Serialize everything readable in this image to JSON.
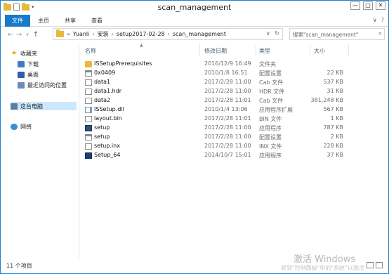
{
  "window": {
    "title": "scan_management"
  },
  "quick_access_toolbar": {
    "items": [
      "folder-icon",
      "properties-icon",
      "new-folder-icon",
      "dropdown-icon"
    ]
  },
  "window_controls": {
    "minimize": "—",
    "maximize": "□",
    "close": "✕"
  },
  "ribbon": {
    "tabs": [
      {
        "label": "文件"
      },
      {
        "label": "主页"
      },
      {
        "label": "共享"
      },
      {
        "label": "查看"
      }
    ],
    "expand_icon": "∨",
    "help_icon": "?"
  },
  "nav": {
    "back": "←",
    "forward": "→",
    "history": "∨",
    "up": "↑"
  },
  "address": {
    "prefix": "«",
    "crumbs": [
      "Yuanli",
      "安装",
      "setup2017-02-28",
      "scan_management"
    ],
    "separator": "›",
    "dropdown": "∨",
    "refresh": "↻"
  },
  "search": {
    "placeholder": "搜索\"scan_management\"",
    "icon": "search-icon"
  },
  "sidebar": {
    "items": [
      {
        "label": "收藏夹",
        "icon": "star-icon"
      },
      {
        "label": "下载",
        "icon": "downloads-icon"
      },
      {
        "label": "桌面",
        "icon": "desktop-icon"
      },
      {
        "label": "最近访问的位置",
        "icon": "recent-places-icon"
      },
      {
        "label": "这台电脑",
        "icon": "computer-icon"
      },
      {
        "label": "网络",
        "icon": "network-icon"
      }
    ]
  },
  "columns": {
    "name": "名称",
    "date": "修改日期",
    "type": "类型",
    "size": "大小"
  },
  "files": [
    {
      "name": "ISSetupPrerequisites",
      "date": "2016/12/9 16:49",
      "type": "文件夹",
      "size": "",
      "icon": "folder"
    },
    {
      "name": "0x0409",
      "date": "2010/1/8 16:51",
      "type": "配置设置",
      "size": "22 KB",
      "icon": "cfg"
    },
    {
      "name": "data1",
      "date": "2017/2/28 11:00",
      "type": "Cab 文件",
      "size": "537 KB",
      "icon": "file"
    },
    {
      "name": "data1.hdr",
      "date": "2017/2/28 11:00",
      "type": "HDR 文件",
      "size": "31 KB",
      "icon": "file"
    },
    {
      "name": "data2",
      "date": "2017/2/28 11:01",
      "type": "Cab 文件",
      "size": "381,248 KB",
      "icon": "file"
    },
    {
      "name": "ISSetup.dll",
      "date": "2010/1/4 13:06",
      "type": "应用程序扩展",
      "size": "567 KB",
      "icon": "dll"
    },
    {
      "name": "layout.bin",
      "date": "2017/2/28 11:01",
      "type": "BIN 文件",
      "size": "1 KB",
      "icon": "file"
    },
    {
      "name": "setup",
      "date": "2017/2/28 11:00",
      "type": "应用程序",
      "size": "787 KB",
      "icon": "app"
    },
    {
      "name": "setup",
      "date": "2017/2/28 11:00",
      "type": "配置设置",
      "size": "2 KB",
      "icon": "cfg"
    },
    {
      "name": "setup.inx",
      "date": "2017/2/28 11:00",
      "type": "INX 文件",
      "size": "228 KB",
      "icon": "file"
    },
    {
      "name": "Setup_64",
      "date": "2014/10/7 15:01",
      "type": "应用程序",
      "size": "37 KB",
      "icon": "exe64"
    }
  ],
  "status": {
    "count": "11 个项目"
  },
  "watermark": {
    "line1": "激活 Windows",
    "line2": "转到\"控制面板\"中的\"系统\"以激活"
  }
}
